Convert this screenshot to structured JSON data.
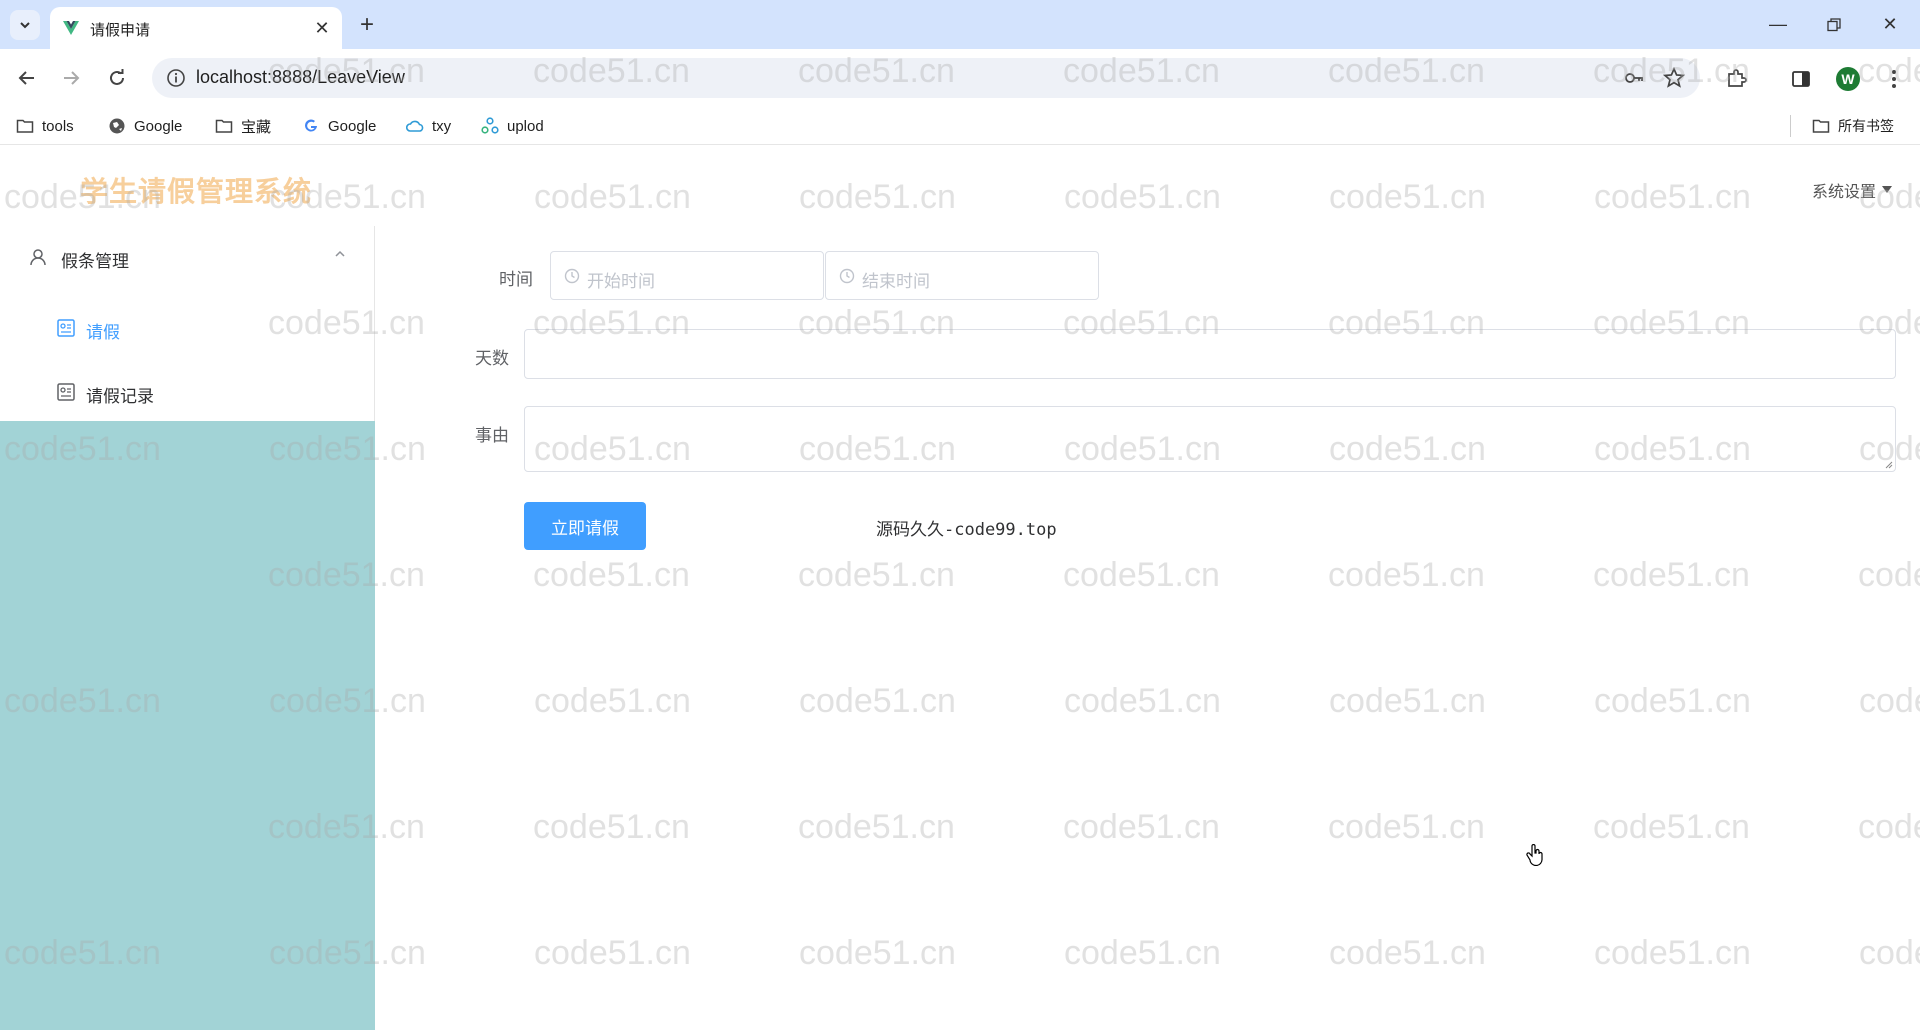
{
  "browser": {
    "tab_title": "请假申请",
    "url": "localhost:8888/LeaveView",
    "profile_initial": "W",
    "bookmarks": [
      {
        "label": "tools",
        "icon": "folder-icon"
      },
      {
        "label": "Google",
        "icon": "globe-icon"
      },
      {
        "label": "宝藏",
        "icon": "folder-icon"
      },
      {
        "label": "Google",
        "icon": "google-g-icon"
      },
      {
        "label": "txy",
        "icon": "cloud-icon"
      },
      {
        "label": "uplod",
        "icon": "share-icon"
      }
    ],
    "all_bookmarks_label": "所有书签"
  },
  "app": {
    "title": "学生请假管理系统",
    "settings_label": "系统设置",
    "sidebar": {
      "group_label": "假条管理",
      "items": [
        {
          "label": "请假",
          "active": true
        },
        {
          "label": "请假记录",
          "active": false
        }
      ]
    },
    "form": {
      "time_label": "时间",
      "start_placeholder": "开始时间",
      "end_placeholder": "结束时间",
      "days_label": "天数",
      "days_value": "",
      "reason_label": "事由",
      "reason_value": "",
      "submit_label": "立即请假"
    },
    "footer_text": "源码久久-code99.top"
  },
  "watermark_text": "code51.cn",
  "colors": {
    "accent": "#409eff",
    "sidebar_bg": "#a2d3d6",
    "app_title": "#f7cf9c",
    "tabbar_bg": "#d3e3fd"
  }
}
